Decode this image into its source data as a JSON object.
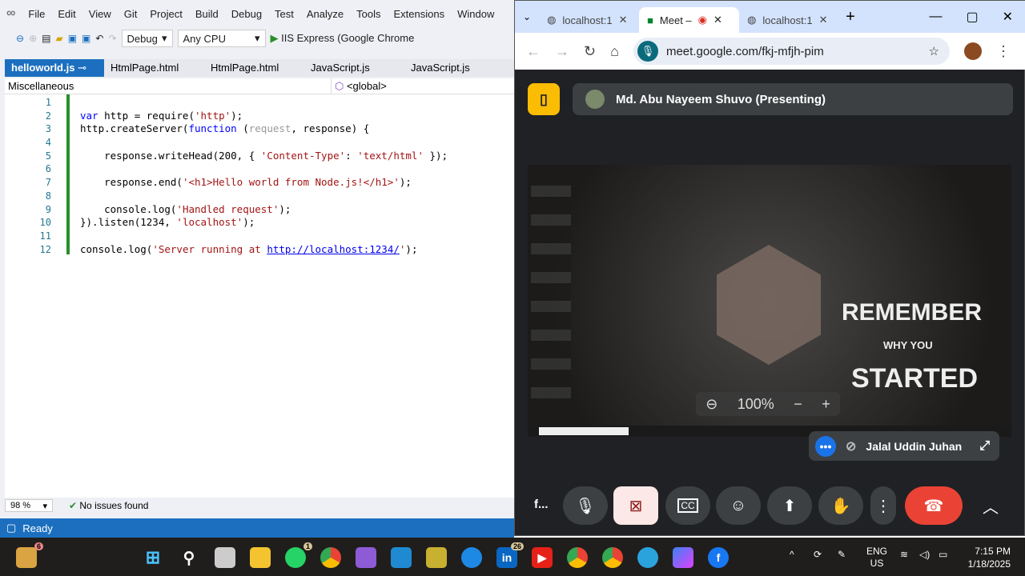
{
  "vs": {
    "menu": [
      "File",
      "Edit",
      "View",
      "Git",
      "Project",
      "Build",
      "Debug",
      "Test",
      "Analyze",
      "Tools",
      "Extensions",
      "Window"
    ],
    "config": "Debug",
    "platform": "Any CPU",
    "run_label": "IIS Express (Google Chrome",
    "tabs": [
      "helloworld.js",
      "HtmlPage.html",
      "HtmlPage.html",
      "JavaScript.js",
      "JavaScript.js"
    ],
    "nav_left": "Miscellaneous",
    "nav_right": "<global>",
    "line_numbers": [
      "1",
      "2",
      "3",
      "4",
      "5",
      "6",
      "7",
      "8",
      "9",
      "10",
      "11",
      "12"
    ],
    "code": [
      [],
      [
        [
          "var",
          "kw"
        ],
        [
          " http = require(",
          ""
        ],
        [
          "'http'",
          "str"
        ],
        [
          ");",
          ""
        ]
      ],
      [
        [
          "http.createServer(",
          ""
        ],
        [
          "function",
          "kw"
        ],
        [
          " (",
          ""
        ],
        [
          "request",
          "par"
        ],
        [
          ", response) {",
          ""
        ]
      ],
      [],
      [
        [
          "    response.writeHead(200, { ",
          ""
        ],
        [
          "'Content-Type'",
          "str"
        ],
        [
          ": ",
          ""
        ],
        [
          "'text/html'",
          "str"
        ],
        [
          " });",
          ""
        ]
      ],
      [],
      [
        [
          "    response.end(",
          ""
        ],
        [
          "'<h1>Hello world from Node.js!</h1>'",
          "str"
        ],
        [
          ");",
          ""
        ]
      ],
      [],
      [
        [
          "    console.log(",
          ""
        ],
        [
          "'Handled request'",
          "str"
        ],
        [
          ");",
          ""
        ]
      ],
      [
        [
          "}).listen(1234, ",
          ""
        ],
        [
          "'localhost'",
          "str"
        ],
        [
          ");",
          ""
        ]
      ],
      [],
      [
        [
          "console.log(",
          ""
        ],
        [
          "'Server running at ",
          "str"
        ],
        [
          "http://localhost:1234/",
          "lnk"
        ],
        [
          "'",
          "str"
        ],
        [
          ");",
          ""
        ]
      ]
    ],
    "zoom": "98 %",
    "issues": "No issues found",
    "status": "Ready"
  },
  "chrome": {
    "tabs": [
      "localhost:1",
      "Meet –",
      "localhost:1"
    ],
    "url": "meet.google.com/fkj-mfjh-pim",
    "presenter": "Md. Abu Nayeem Shuvo (Presenting)",
    "shared_text": [
      "REMEMBER",
      "WHY YOU",
      "STARTED"
    ],
    "shared_zoom": "100%",
    "pip_name": "Jalal Uddin Juhan",
    "meeting_code": "f...",
    "end_call_color": "#ea4335",
    "camera_off_color": "#fce8e6"
  },
  "taskbar": {
    "weather_badge": "6",
    "whatsapp_badge": "1",
    "linkedin_badge": "26",
    "lang1": "ENG",
    "lang2": "US",
    "time": "7:15 PM",
    "date": "1/18/2025"
  }
}
